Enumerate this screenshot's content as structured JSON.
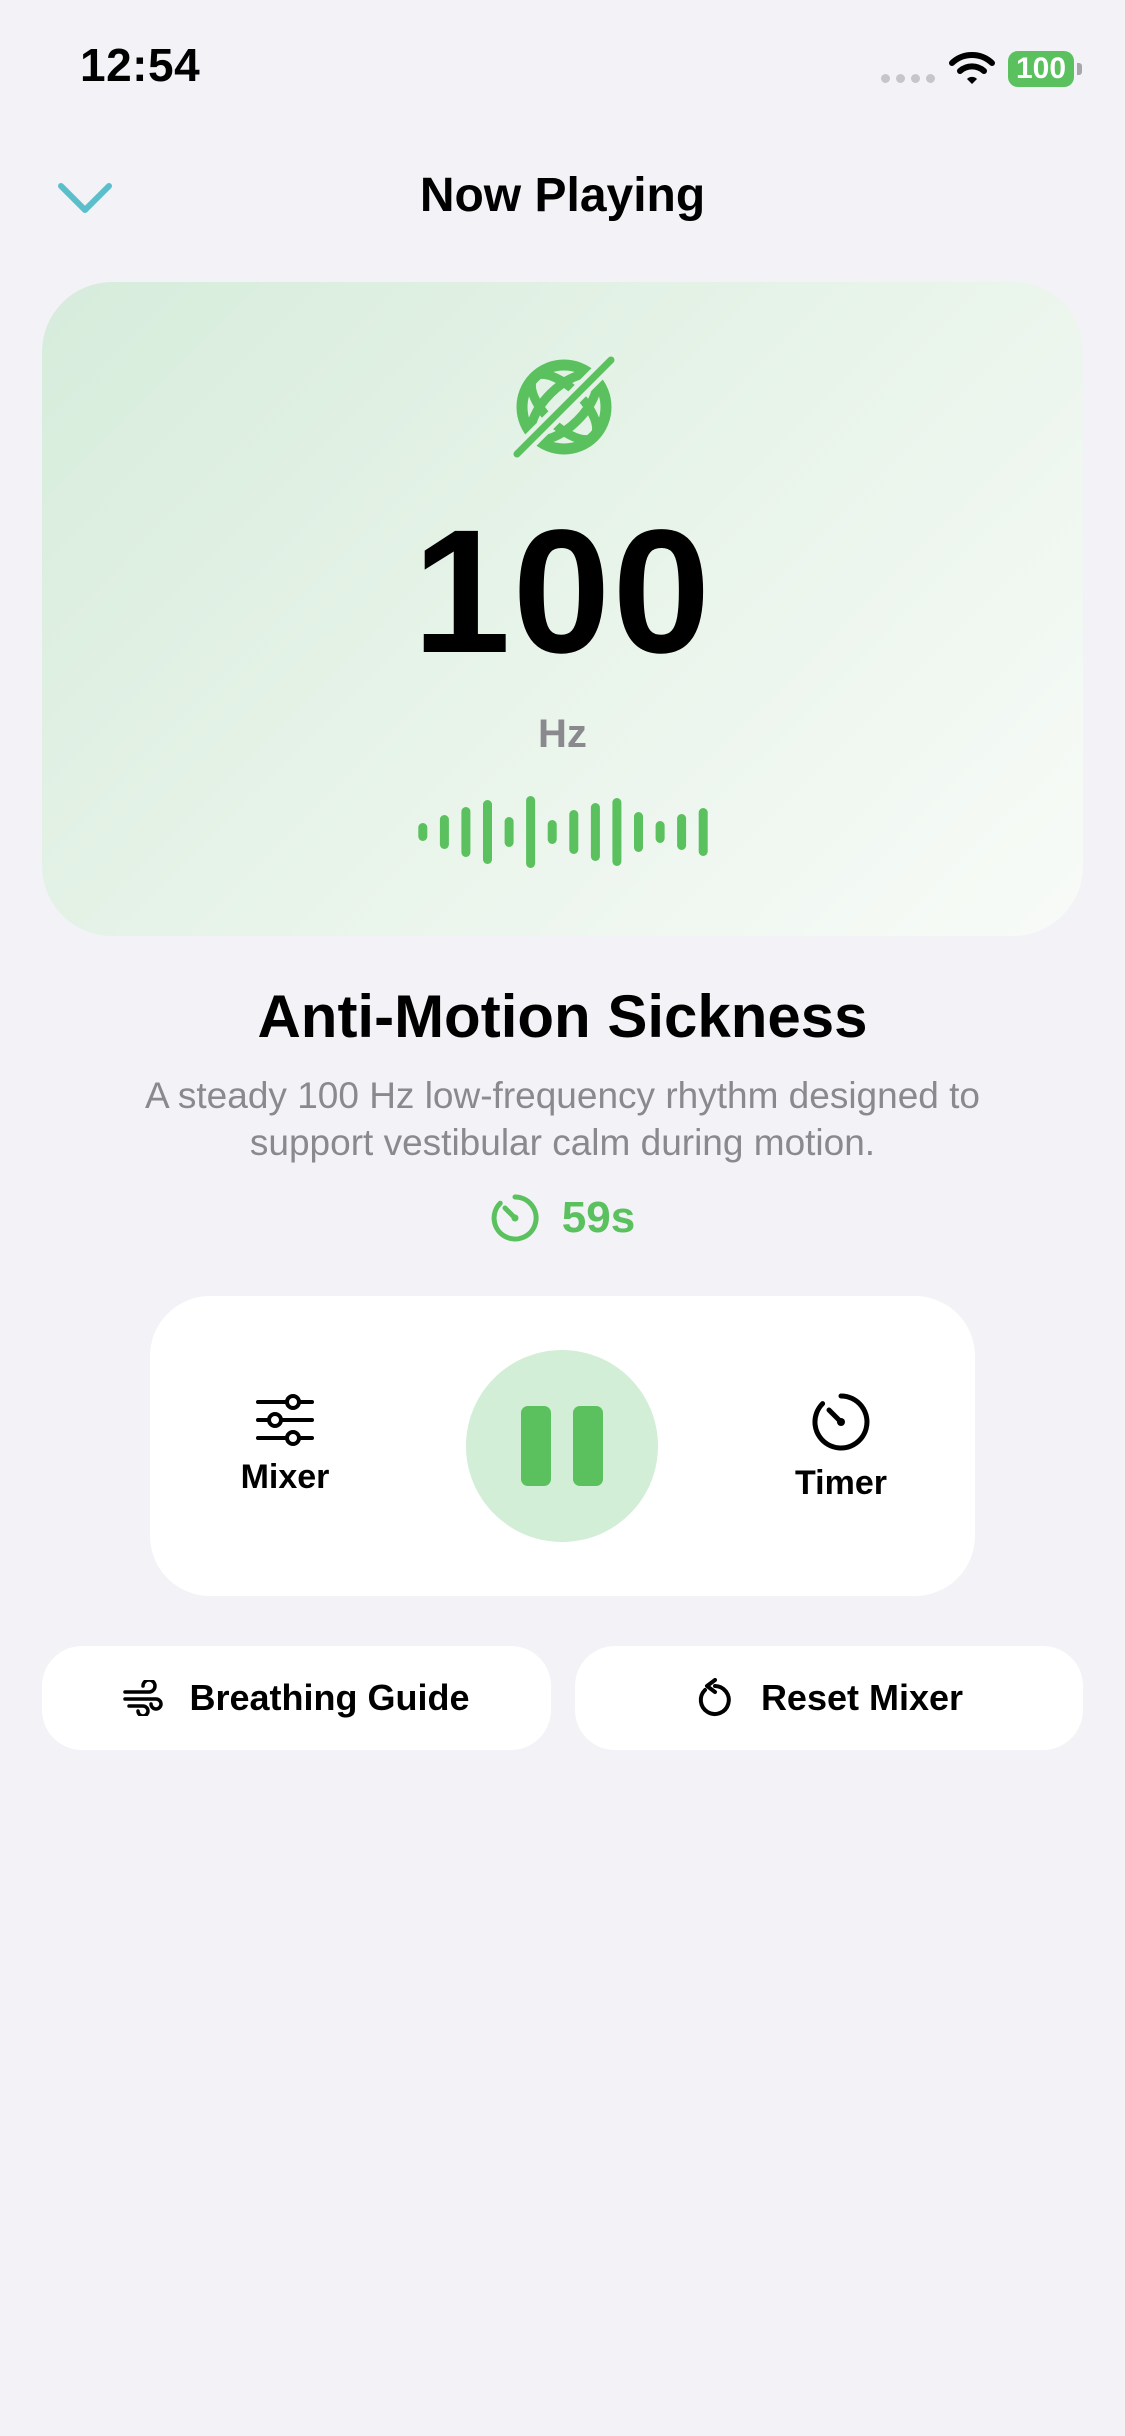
{
  "status_bar": {
    "time": "12:54",
    "battery": "100"
  },
  "nav": {
    "title": "Now Playing"
  },
  "hero": {
    "frequency": "100",
    "unit": "Hz"
  },
  "sound": {
    "title": "Anti-Motion Sickness",
    "description": "A steady 100 Hz low-frequency rhythm designed to support vestibular calm during motion.",
    "remaining": "59s"
  },
  "controls": {
    "mixer_label": "Mixer",
    "timer_label": "Timer"
  },
  "actions": {
    "breathing_label": "Breathing Guide",
    "reset_label": "Reset Mixer"
  },
  "colors": {
    "accent": "#5ac15e",
    "accent_soft": "#d3eed6",
    "nav_tint": "#5abfcb",
    "background": "#f2f2f7"
  },
  "icons": [
    "chevron-down-icon",
    "wifi-icon",
    "battery-icon",
    "motion-sickness-icon",
    "waveform-icon",
    "timer-icon",
    "sliders-icon",
    "pause-icon",
    "wind-icon",
    "reset-icon"
  ]
}
